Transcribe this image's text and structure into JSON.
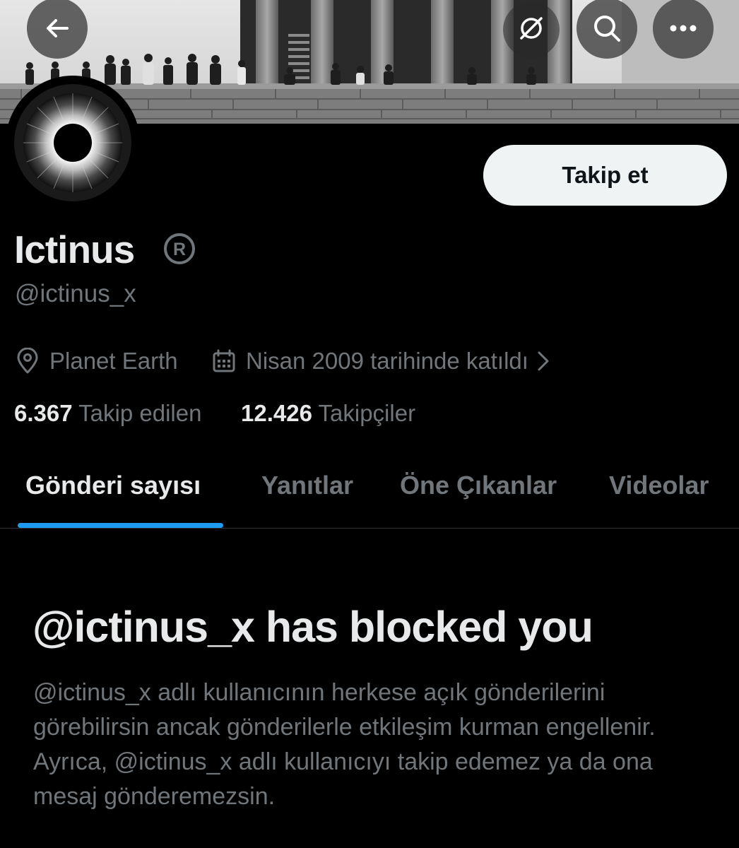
{
  "header": {
    "back_icon": "arrow-left-icon",
    "grok_icon": "slashed-circle-icon",
    "search_icon": "search-icon",
    "more_icon": "more-horizontal-icon"
  },
  "profile": {
    "display_name": "Ictinus",
    "name_badge": "registered-mark-icon",
    "handle": "@ictinus_x",
    "follow_label": "Takip et",
    "location": "Planet Earth",
    "joined": "Nisan 2009 tarihinde katıldı",
    "following_count": "6.367",
    "following_label": "Takip edilen",
    "followers_count": "12.426",
    "followers_label": "Takipçiler"
  },
  "tabs": [
    {
      "label": "Gönderi sayısı",
      "active": true
    },
    {
      "label": "Yanıtlar",
      "active": false
    },
    {
      "label": "Öne Çıkanlar",
      "active": false
    },
    {
      "label": "Videolar",
      "active": false
    }
  ],
  "blocked": {
    "title": "@ictinus_x has blocked you",
    "body": "@ictinus_x adlı kullanıcının herkese açık gönderilerini görebilirsin ancak gönderilerle etkileşim kurman engellenir. Ayrıca, @ictinus_x adlı kullanıcıyı takip edemez ya da ona mesaj gönderemezsin."
  },
  "colors": {
    "background": "#000000",
    "text_primary": "#e7e9ea",
    "text_secondary": "#71767b",
    "accent_blue": "#1d9bf0",
    "follow_button_bg": "#eff3f4"
  }
}
